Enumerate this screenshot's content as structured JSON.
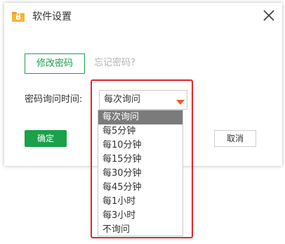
{
  "window": {
    "title": "软件设置",
    "icon": "folder-lock-icon",
    "close_icon": "close-icon"
  },
  "password": {
    "change_button_label": "修改密码",
    "forgot_link_label": "忘记密码?"
  },
  "ask_interval": {
    "label": "密码询问时间:",
    "selected_value": "每次询问",
    "options": [
      "每次询问",
      "每5分钟",
      "每10分钟",
      "每15分钟",
      "每30分钟",
      "每45分钟",
      "每1小时",
      "每3小时",
      "不询问"
    ],
    "highlighted_index": 0
  },
  "footer": {
    "confirm_label": "确定",
    "cancel_label": "取消"
  },
  "colors": {
    "accent_green": "#1aa14a",
    "arrow_orange": "#f05a28",
    "highlight_red": "#e8232b",
    "selected_item_bg": "#7b7b7b"
  }
}
